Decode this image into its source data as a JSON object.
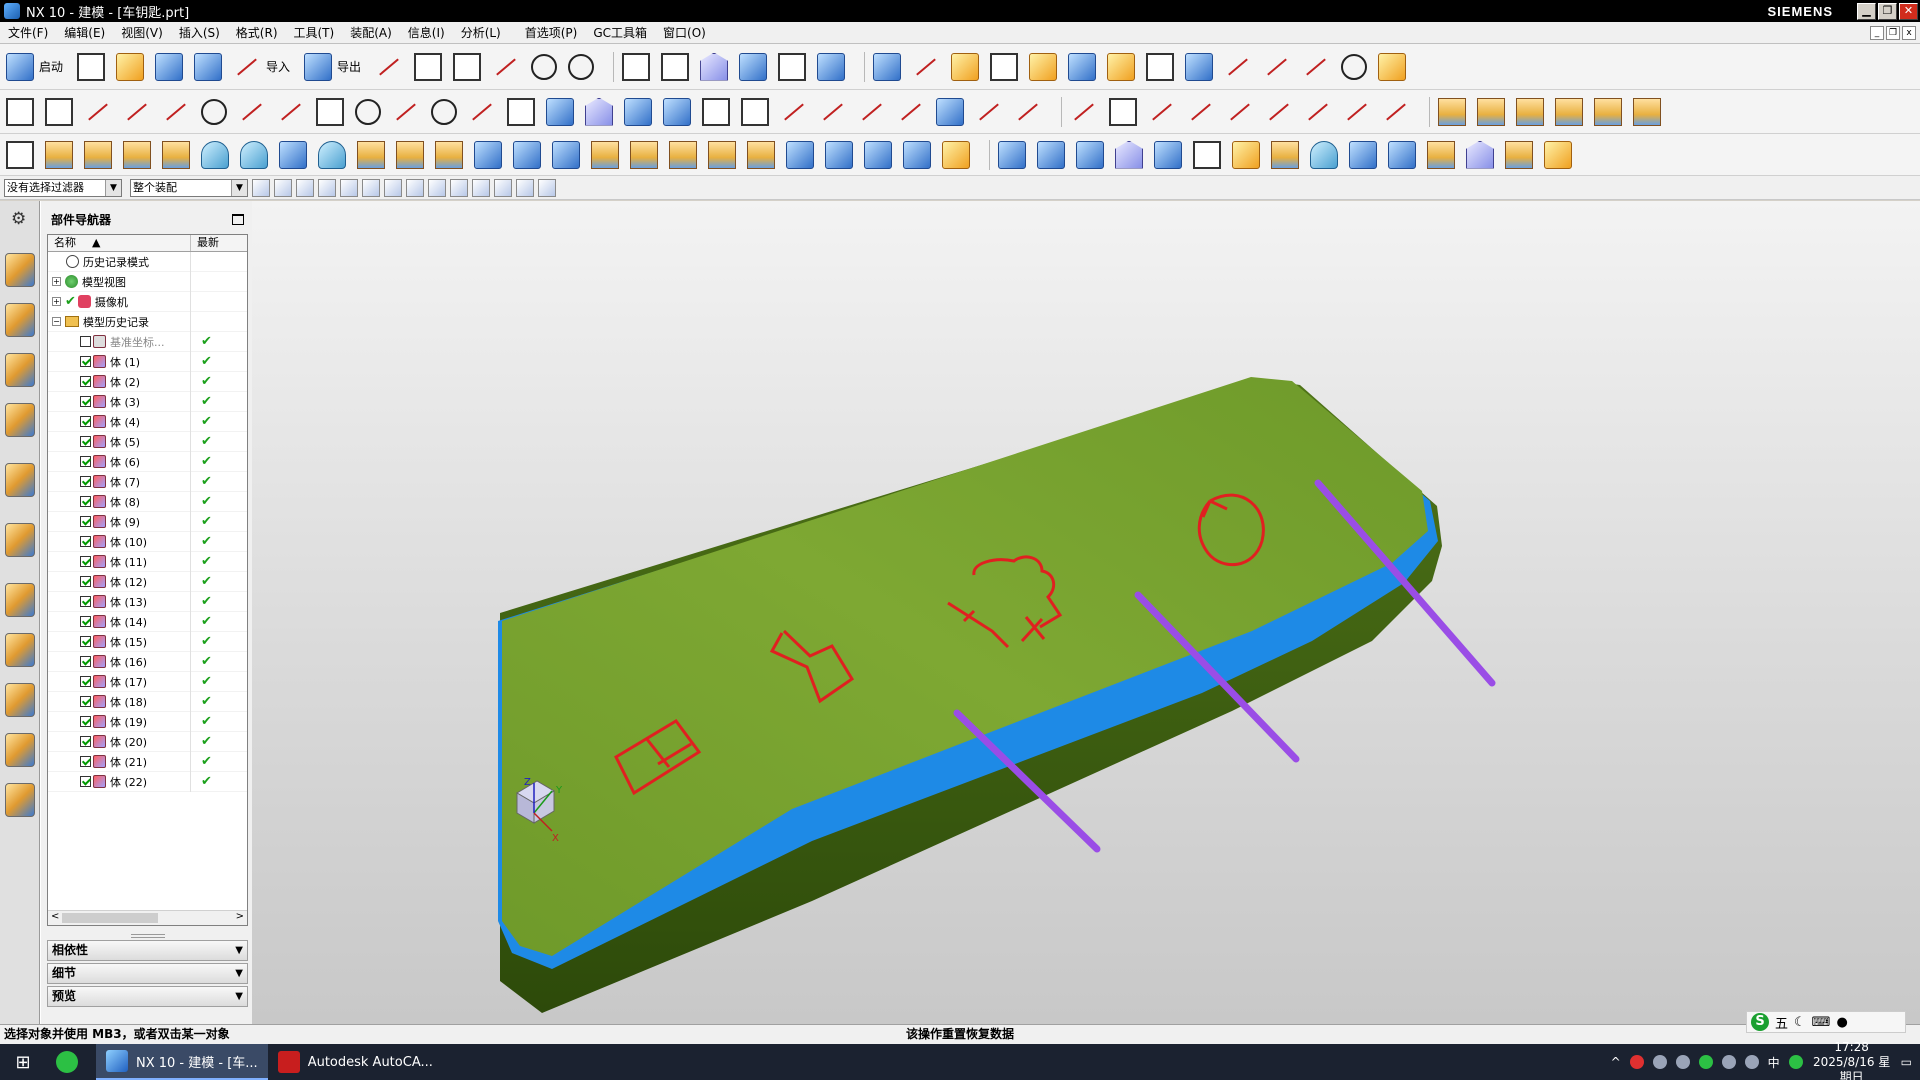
{
  "window": {
    "title": "NX 10 - 建模 - [车钥匙.prt]",
    "brand": "SIEMENS",
    "minimize": "▁",
    "restore": "❐",
    "close": "✕"
  },
  "menu": {
    "items": [
      "文件(F)",
      "编辑(E)",
      "视图(V)",
      "插入(S)",
      "格式(R)",
      "工具(T)",
      "装配(A)",
      "信息(I)",
      "分析(L)",
      "首选项(P)",
      "GC工具箱",
      "窗口(O)"
    ]
  },
  "toolbar": {
    "start_label": "启动",
    "import_label": "导入",
    "export_label": "导出"
  },
  "selection_bar": {
    "filter": "没有选择过滤器",
    "scope": "整个装配"
  },
  "navigator": {
    "title": "部件导航器",
    "columns": {
      "name": "名称",
      "latest": "最新"
    },
    "top_nodes": [
      "历史记录模式",
      "模型视图",
      "摄像机",
      "模型历史记录"
    ],
    "datum": "基准坐标...",
    "bodies": [
      "体 (1)",
      "体 (2)",
      "体 (3)",
      "体 (4)",
      "体 (5)",
      "体 (6)",
      "体 (7)",
      "体 (8)",
      "体 (9)",
      "体 (10)",
      "体 (11)",
      "体 (12)",
      "体 (13)",
      "体 (14)",
      "体 (15)",
      "体 (16)",
      "体 (17)",
      "体 (18)",
      "体 (19)",
      "体 (20)",
      "体 (21)",
      "体 (22)"
    ],
    "check": "✔",
    "panels": [
      "相依性",
      "细节",
      "预览"
    ]
  },
  "triad": {
    "x": "X",
    "y": "Y",
    "z": "Z"
  },
  "status": {
    "left": "选择对象并使用 MB3，或者双击某一对象",
    "middle": "该操作重置恢复数据"
  },
  "ime": {
    "logo": "S",
    "mode": "五"
  },
  "taskbar": {
    "apps": [
      {
        "label": "NX 10 - 建模 - [车..."
      },
      {
        "label": "Autodesk AutoCA..."
      }
    ],
    "time": "17:28",
    "date": "2025/8/16 星期日",
    "lang": "中"
  },
  "colors": {
    "body_green": "#6f9a2a",
    "edge_blue": "#1e8ae6",
    "button_line": "#9a4de6",
    "symbol_red": "#e02020"
  }
}
